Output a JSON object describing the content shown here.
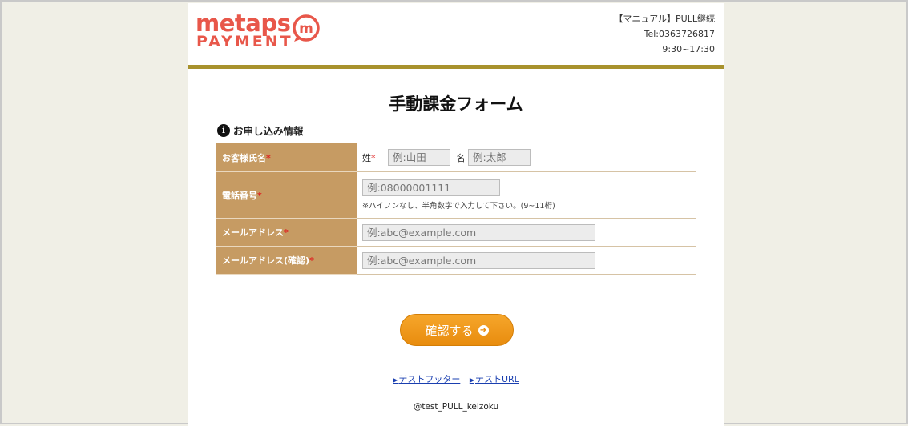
{
  "brand": {
    "line1": "metaps",
    "line2": "PAYMENT",
    "mark": "m",
    "color": "#e8574a"
  },
  "contact": {
    "line1": "【マニュアル】PULL継続",
    "tel": "Tel:0363726817",
    "hours": "9:30~17:30"
  },
  "page_title": "手動課金フォーム",
  "section_title": "お申し込み情報",
  "form": {
    "name_label": "お客様氏名",
    "last_label": "姓",
    "last_placeholder": "例:山田",
    "first_label": "名",
    "first_placeholder": "例:太郎",
    "phone_label": "電話番号",
    "phone_placeholder": "例:08000001111",
    "phone_hint": "※ハイフンなし、半角数字で入力して下さい。(9~11桁)",
    "email_label": "メールアドレス",
    "email_placeholder": "例:abc@example.com",
    "email_confirm_label": "メールアドレス(確認)",
    "email_confirm_placeholder": "例:abc@example.com",
    "required_mark": "*"
  },
  "confirm_button": "確認する",
  "footer": {
    "link1": "テストフッター",
    "link2": "テストURL",
    "copyright": "@test_PULL_keizoku"
  },
  "colors": {
    "accent_bar": "#a8922d",
    "label_bg": "#c69b63",
    "button": "#f0991c"
  }
}
